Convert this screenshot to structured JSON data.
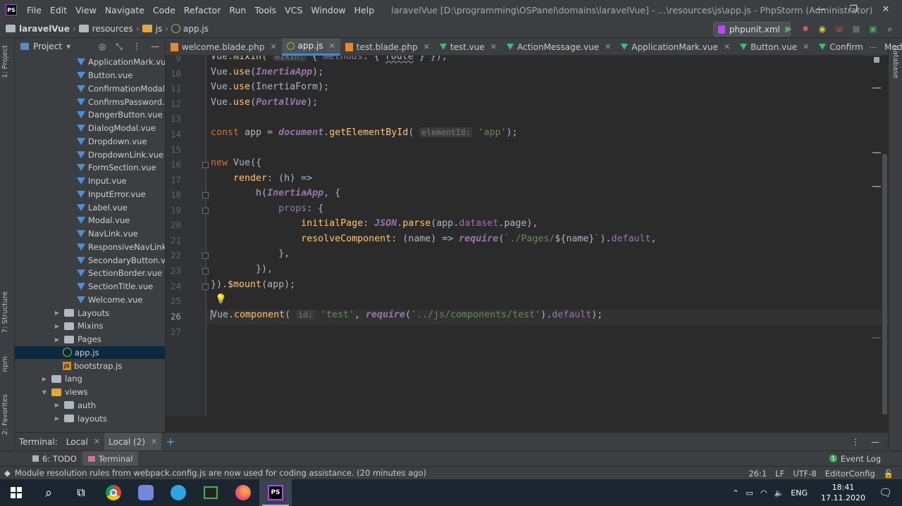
{
  "app": {
    "logo": "PS",
    "menu": [
      "File",
      "Edit",
      "View",
      "Navigate",
      "Code",
      "Refactor",
      "Run",
      "Tools",
      "VCS",
      "Window",
      "Help"
    ],
    "window_title": "laravelVue [D:\\programming\\OSPanel\\domains\\laravelVue] - ...\\resources\\js\\app.js - PhpStorm (Administrator)",
    "window_controls": [
      "—",
      "❐",
      "✕"
    ]
  },
  "navbar": {
    "crumbs": [
      "laravelVue",
      "resources",
      "js",
      "app.js"
    ],
    "run_config": "phpunit.xml"
  },
  "left_tool_tabs": [
    "1: Project",
    "7: Structure",
    "npm",
    "2: Favorites"
  ],
  "right_tool_tabs": [
    "Database"
  ],
  "project_panel": {
    "title": "Project",
    "items": [
      {
        "label": "ApplicationMark.vue",
        "type": "vue",
        "indent": 88
      },
      {
        "label": "Button.vue",
        "type": "vue",
        "indent": 88
      },
      {
        "label": "ConfirmationModal.vue",
        "type": "vue",
        "indent": 88
      },
      {
        "label": "ConfirmsPassword.vue",
        "type": "vue",
        "indent": 88
      },
      {
        "label": "DangerButton.vue",
        "type": "vue",
        "indent": 88
      },
      {
        "label": "DialogModal.vue",
        "type": "vue",
        "indent": 88
      },
      {
        "label": "Dropdown.vue",
        "type": "vue",
        "indent": 88
      },
      {
        "label": "DropdownLink.vue",
        "type": "vue",
        "indent": 88
      },
      {
        "label": "FormSection.vue",
        "type": "vue",
        "indent": 88
      },
      {
        "label": "Input.vue",
        "type": "vue",
        "indent": 88
      },
      {
        "label": "InputError.vue",
        "type": "vue",
        "indent": 88
      },
      {
        "label": "Label.vue",
        "type": "vue",
        "indent": 88
      },
      {
        "label": "Modal.vue",
        "type": "vue",
        "indent": 88
      },
      {
        "label": "NavLink.vue",
        "type": "vue",
        "indent": 88
      },
      {
        "label": "ResponsiveNavLink.vue",
        "type": "vue",
        "indent": 88
      },
      {
        "label": "SecondaryButton.vue",
        "type": "vue",
        "indent": 88
      },
      {
        "label": "SectionBorder.vue",
        "type": "vue",
        "indent": 88
      },
      {
        "label": "SectionTitle.vue",
        "type": "vue",
        "indent": 88
      },
      {
        "label": "Welcome.vue",
        "type": "vue",
        "indent": 88
      },
      {
        "label": "Layouts",
        "type": "folder",
        "indent": 54,
        "arrow": "▶"
      },
      {
        "label": "Mixins",
        "type": "folder",
        "indent": 54,
        "arrow": "▶"
      },
      {
        "label": "Pages",
        "type": "folder",
        "indent": 54,
        "arrow": "▶"
      },
      {
        "label": "app.js",
        "type": "js",
        "indent": 68,
        "selected": true
      },
      {
        "label": "bootstrap.js",
        "type": "js2",
        "indent": 68
      },
      {
        "label": "lang",
        "type": "folder",
        "indent": 36,
        "arrow": "▶"
      },
      {
        "label": "views",
        "type": "folderY",
        "indent": 36,
        "arrow": "▼"
      },
      {
        "label": "auth",
        "type": "folder",
        "indent": 54,
        "arrow": "▶"
      },
      {
        "label": "layouts",
        "type": "folder",
        "indent": 54,
        "arrow": "▶"
      }
    ]
  },
  "tabs": [
    {
      "label": "welcome.blade.php",
      "icon": "php",
      "active": false
    },
    {
      "label": "app.js",
      "icon": "js",
      "active": true
    },
    {
      "label": "test.blade.php",
      "icon": "php",
      "active": false
    },
    {
      "label": "test.vue",
      "icon": "vue",
      "active": false
    },
    {
      "label": "ActionMessage.vue",
      "icon": "vue",
      "active": false
    },
    {
      "label": "ApplicationMark.vue",
      "icon": "vue",
      "active": false
    },
    {
      "label": "Button.vue",
      "icon": "vue",
      "active": false
    },
    {
      "label": "ConfirmationModal.vue",
      "icon": "vue",
      "active": false
    }
  ],
  "editor": {
    "line_numbers": [
      "9",
      "10",
      "11",
      "12",
      "13",
      "14",
      "15",
      "16",
      "17",
      "18",
      "19",
      "20",
      "21",
      "22",
      "23",
      "24",
      "25",
      "26",
      "27"
    ],
    "current_line": "26"
  },
  "terminal": {
    "label": "Terminal:",
    "tabs": [
      "Local",
      "Local (2)"
    ]
  },
  "bottom_tools": {
    "todo": "6: TODO",
    "terminal": "Terminal",
    "event_log": "Event Log"
  },
  "status": {
    "message": "Module resolution rules from webpack.config.js are now used for coding assistance. (20 minutes ago)",
    "position": "26:1",
    "line_sep": "LF",
    "encoding": "UTF-8",
    "editorconfig": "EditorConfig"
  },
  "taskbar": {
    "lang": "ENG",
    "time": "18:41",
    "date": "17.11.2020"
  }
}
